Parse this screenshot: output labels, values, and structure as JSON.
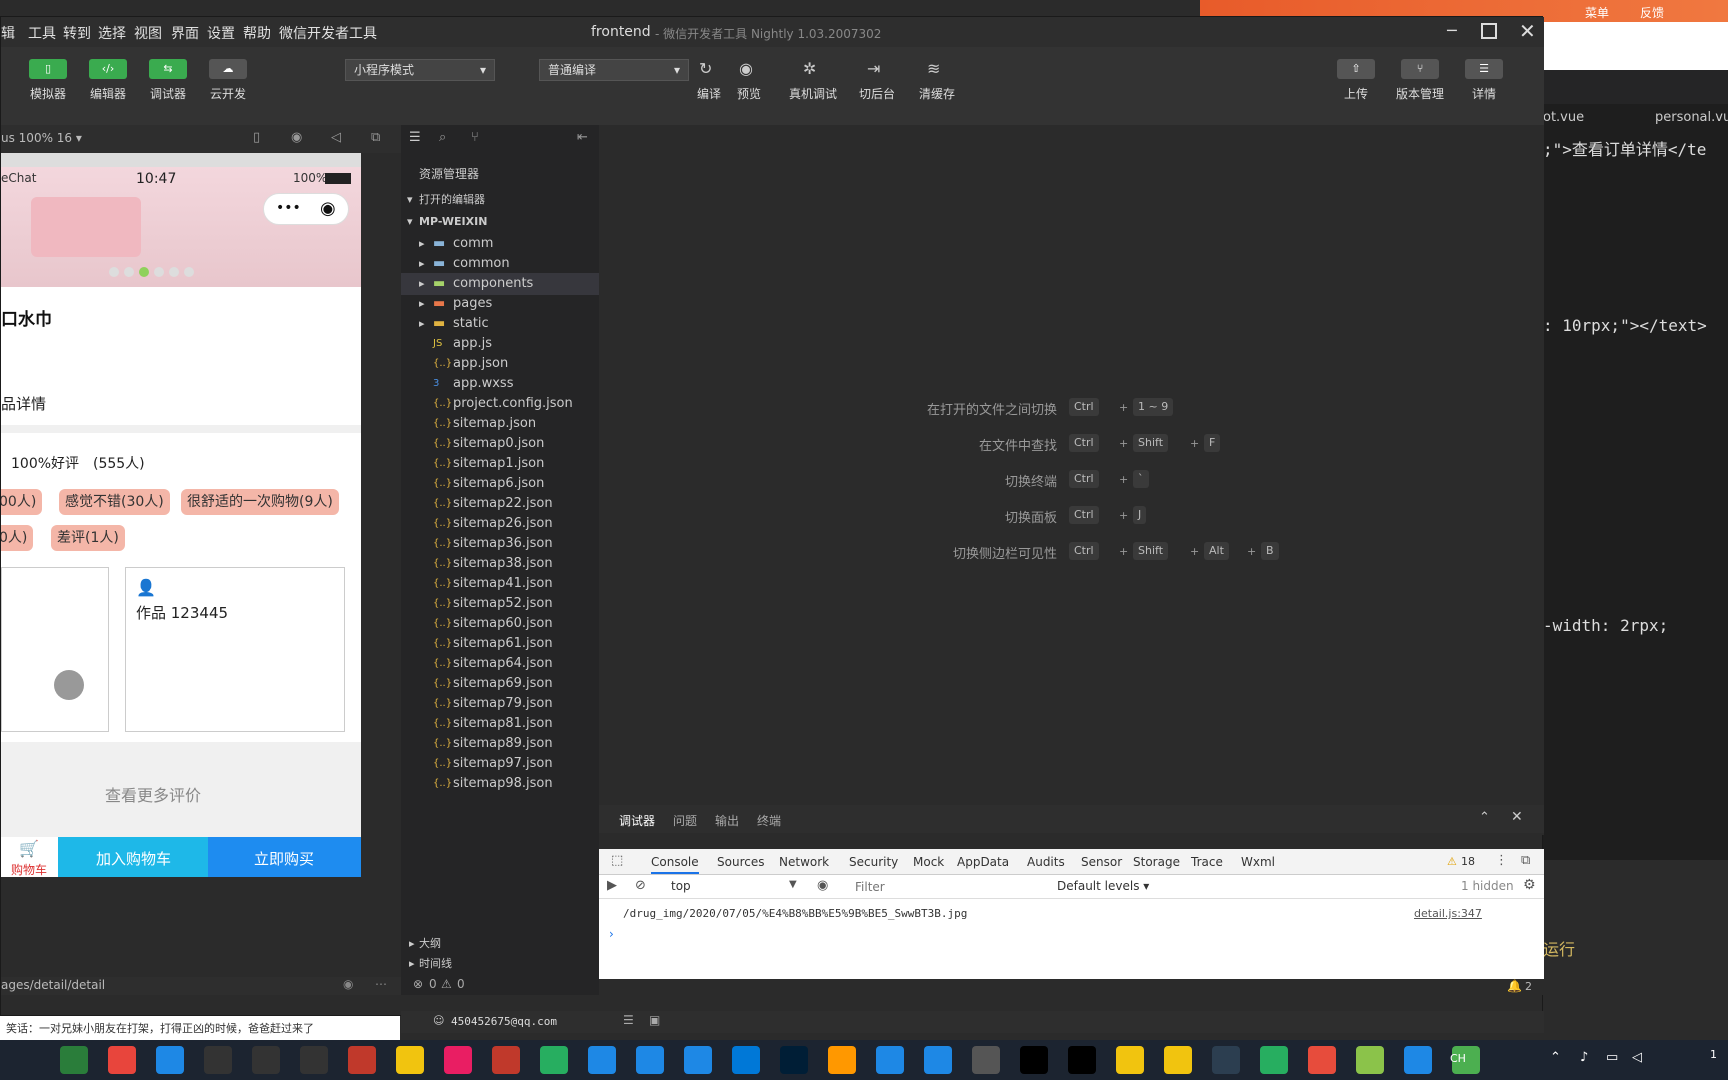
{
  "window": {
    "title": "frontend",
    "subtitle": "- 微信开发者工具 Nightly 1.03.2007302",
    "menus": [
      "辑",
      "工具",
      "转到",
      "选择",
      "视图",
      "界面",
      "设置",
      "帮助",
      "微信开发者工具"
    ]
  },
  "background_app": {
    "top_links": [
      "菜单",
      "反馈"
    ],
    "tabs": [
      "ot.vue",
      "personal.vue"
    ],
    "code_lines": [
      ";\">查看订单详情</te",
      ": 10rpx;\"></text>",
      "-width: 2rpx;",
      "运行"
    ]
  },
  "toolbar": {
    "left_buttons": [
      "模拟器",
      "编辑器",
      "调试器",
      "云开发"
    ],
    "mode_select": "小程序模式",
    "compile_select": "普通编译",
    "mid_buttons": [
      "编译",
      "预览",
      "真机调试",
      "切后台",
      "清缓存"
    ],
    "right_buttons": [
      "上传",
      "版本管理",
      "详情"
    ]
  },
  "simulator": {
    "device_label": "us 100% 16 ▾",
    "status_bar": {
      "carrier": "eChat",
      "time": "10:47",
      "battery": "100%"
    },
    "product_title": "口水巾",
    "product_detail_link": "品详情",
    "rating": "100%好评",
    "rating_count": "(555人)",
    "tags": [
      "00人)",
      "感觉不错(30人)",
      "很舒适的一次购物(9人)",
      "0人)",
      "差评(1人)"
    ],
    "review_user": "作品 123445",
    "more_reviews": "查看更多评价",
    "bottom": {
      "cart": "购物车",
      "add_cart": "加入购物车",
      "buy_now": "立即购买"
    },
    "page_path": "ages/detail/detail"
  },
  "explorer": {
    "header": "资源管理器",
    "open_editors": "打开的编辑器",
    "root": "MP-WEIXIN",
    "folders": [
      "comm",
      "common",
      "components",
      "pages",
      "static"
    ],
    "files": [
      "app.js",
      "app.json",
      "app.wxss",
      "project.config.json",
      "sitemap.json",
      "sitemap0.json",
      "sitemap1.json",
      "sitemap6.json",
      "sitemap22.json",
      "sitemap26.json",
      "sitemap36.json",
      "sitemap38.json",
      "sitemap41.json",
      "sitemap52.json",
      "sitemap60.json",
      "sitemap61.json",
      "sitemap64.json",
      "sitemap69.json",
      "sitemap79.json",
      "sitemap81.json",
      "sitemap89.json",
      "sitemap97.json",
      "sitemap98.json"
    ],
    "outline": "大纲",
    "timeline": "时间线"
  },
  "editor_hints": [
    {
      "label": "在打开的文件之间切换",
      "keys": [
        "Ctrl",
        "1 ~ 9"
      ]
    },
    {
      "label": "在文件中查找",
      "keys": [
        "Ctrl",
        "Shift",
        "F"
      ]
    },
    {
      "label": "切换终端",
      "keys": [
        "Ctrl",
        "`"
      ]
    },
    {
      "label": "切换面板",
      "keys": [
        "Ctrl",
        "J"
      ]
    },
    {
      "label": "切换侧边栏可见性",
      "keys": [
        "Ctrl",
        "Shift",
        "Alt",
        "B"
      ]
    }
  ],
  "panel": {
    "tabs": [
      "调试器",
      "问题",
      "输出",
      "终端"
    ],
    "dev_tabs": [
      "Console",
      "Sources",
      "Network",
      "Security",
      "Mock",
      "AppData",
      "Audits",
      "Sensor",
      "Storage",
      "Trace",
      "Wxml"
    ],
    "warn_count": "18",
    "context": "top",
    "filter_placeholder": "Filter",
    "levels": "Default levels ▾",
    "hidden": "1 hidden",
    "log_line": "/drug_img/2020/07/05/%E4%B8%BB%E5%9B%BE5_SwwBT3B.jpg",
    "log_source": "detail.js:347"
  },
  "statusbar": {
    "errors": "0",
    "warnings": "0",
    "user": "450452675@qq.com",
    "notifications": "2"
  },
  "bottom_text": "笑话：一对兄妹小朋友在打架，打得正凶的时候，爸爸赶过来了",
  "taskbar": {
    "ime": "CH",
    "clock": "1"
  }
}
